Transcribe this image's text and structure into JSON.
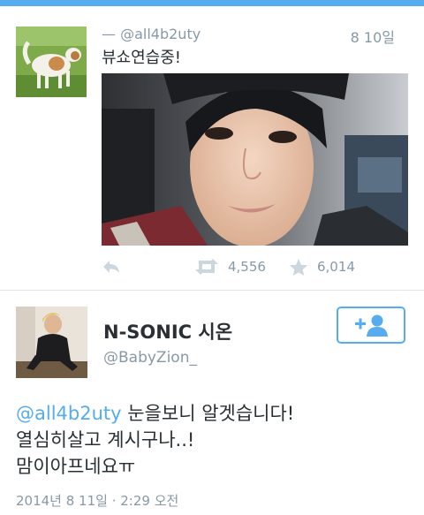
{
  "status_bar_color": "#55acee",
  "tweet_parent": {
    "display_name": "—",
    "handle": "@all4b2uty",
    "timestamp": "8 10일",
    "text": "뷰쇼연습중!",
    "retweets": "4,556",
    "favorites": "6,014",
    "icons": {
      "reply": "reply-icon",
      "retweet": "retweet-icon",
      "favorite": "star-icon"
    }
  },
  "tweet_reply": {
    "display_name": "N-SONIC 시온",
    "handle": "@BabyZion_",
    "follow_icon": "add-user-icon",
    "mention": "@all4b2uty",
    "line1_rest": " 눈을보니 알겟습니다!",
    "line2": "열심히살고 계시구나..!",
    "line3": "맘이아프네요ㅠ",
    "date": "2014년 8 11일 · 2:29 오전"
  },
  "colors": {
    "accent": "#55acee",
    "muted": "#8899a6",
    "text": "#292f33"
  }
}
